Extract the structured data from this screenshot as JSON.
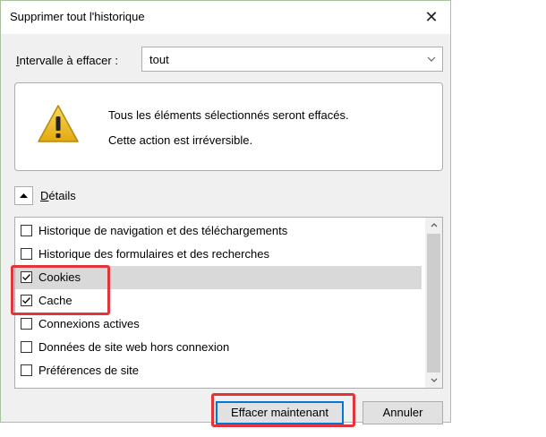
{
  "dialog": {
    "title": "Supprimer tout l'historique",
    "close_glyph": "✕"
  },
  "range": {
    "label_access_key": "I",
    "label_rest": "ntervalle à effacer :",
    "value": "tout",
    "chevron_icon": "chevron-down-icon"
  },
  "warning": {
    "icon": "warning-triangle-icon",
    "line1": "Tous les éléments sélectionnés seront effacés.",
    "line2": "Cette action est irréversible."
  },
  "details": {
    "label_access_key": "D",
    "label_rest": "étails",
    "toggle_icon": "chevron-up-icon"
  },
  "items": [
    {
      "label": "Historique de navigation et des téléchargements",
      "checked": false
    },
    {
      "label": "Historique des formulaires et des recherches",
      "checked": false
    },
    {
      "label": "Cookies",
      "checked": true
    },
    {
      "label": "Cache",
      "checked": true
    },
    {
      "label": "Connexions actives",
      "checked": false
    },
    {
      "label": "Données de site web hors connexion",
      "checked": false
    },
    {
      "label": "Préférences de site",
      "checked": false
    }
  ],
  "buttons": {
    "clear_now": "Effacer maintenant",
    "cancel": "Annuler"
  },
  "colors": {
    "highlight": "#e2343b",
    "focus_border": "#0078d7",
    "selected_row": "#d9d9d9"
  }
}
